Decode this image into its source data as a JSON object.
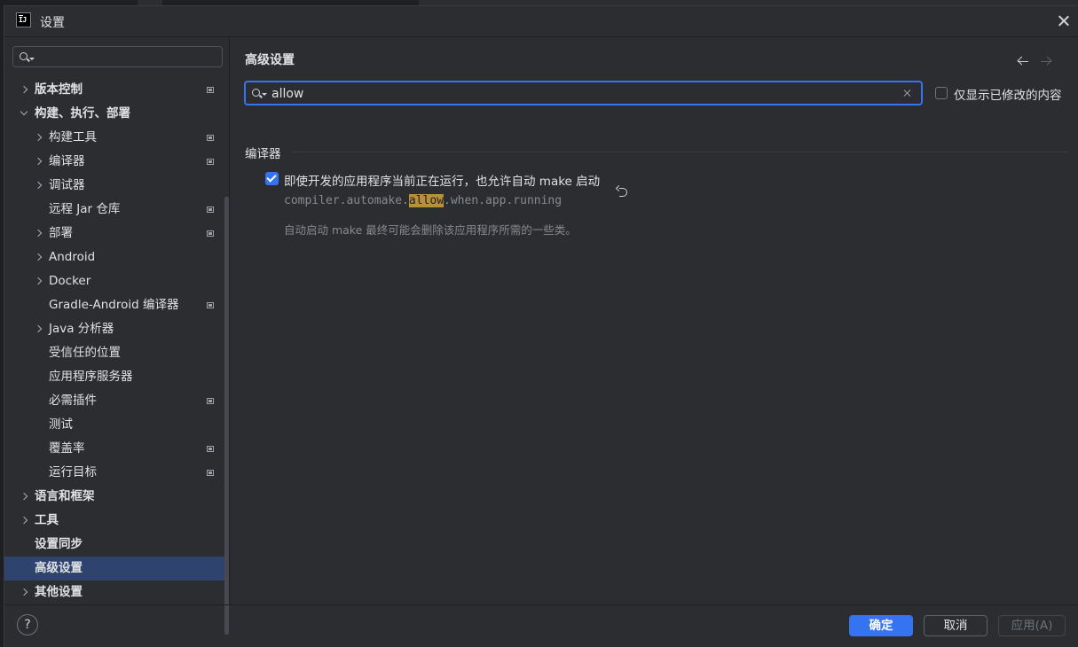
{
  "window": {
    "title": "设置",
    "logo_text": "IJ"
  },
  "sidebar": {
    "search_value": "",
    "items": [
      {
        "label": "版本控制",
        "level": 0,
        "expand": "collapsed",
        "bold": true,
        "has_icon": true,
        "selected": false
      },
      {
        "label": "构建、执行、部署",
        "level": 0,
        "expand": "expanded",
        "bold": true,
        "has_icon": false,
        "selected": false
      },
      {
        "label": "构建工具",
        "level": 1,
        "expand": "collapsed",
        "bold": false,
        "has_icon": true,
        "selected": false
      },
      {
        "label": "编译器",
        "level": 1,
        "expand": "collapsed",
        "bold": false,
        "has_icon": true,
        "selected": false
      },
      {
        "label": "调试器",
        "level": 1,
        "expand": "collapsed",
        "bold": false,
        "has_icon": false,
        "selected": false
      },
      {
        "label": "远程 Jar 仓库",
        "level": 1,
        "expand": "none",
        "bold": false,
        "has_icon": true,
        "selected": false
      },
      {
        "label": "部署",
        "level": 1,
        "expand": "collapsed",
        "bold": false,
        "has_icon": true,
        "selected": false
      },
      {
        "label": "Android",
        "level": 1,
        "expand": "collapsed",
        "bold": false,
        "has_icon": false,
        "selected": false
      },
      {
        "label": "Docker",
        "level": 1,
        "expand": "collapsed",
        "bold": false,
        "has_icon": false,
        "selected": false
      },
      {
        "label": "Gradle-Android 编译器",
        "level": 1,
        "expand": "none",
        "bold": false,
        "has_icon": true,
        "selected": false
      },
      {
        "label": "Java 分析器",
        "level": 1,
        "expand": "collapsed",
        "bold": false,
        "has_icon": false,
        "selected": false
      },
      {
        "label": "受信任的位置",
        "level": 1,
        "expand": "none",
        "bold": false,
        "has_icon": false,
        "selected": false
      },
      {
        "label": "应用程序服务器",
        "level": 1,
        "expand": "none",
        "bold": false,
        "has_icon": false,
        "selected": false
      },
      {
        "label": "必需插件",
        "level": 1,
        "expand": "none",
        "bold": false,
        "has_icon": true,
        "selected": false
      },
      {
        "label": "测试",
        "level": 1,
        "expand": "none",
        "bold": false,
        "has_icon": false,
        "selected": false
      },
      {
        "label": "覆盖率",
        "level": 1,
        "expand": "none",
        "bold": false,
        "has_icon": true,
        "selected": false
      },
      {
        "label": "运行目标",
        "level": 1,
        "expand": "none",
        "bold": false,
        "has_icon": true,
        "selected": false
      },
      {
        "label": "语言和框架",
        "level": 0,
        "expand": "collapsed",
        "bold": true,
        "has_icon": false,
        "selected": false
      },
      {
        "label": "工具",
        "level": 0,
        "expand": "collapsed",
        "bold": true,
        "has_icon": false,
        "selected": false
      },
      {
        "label": "设置同步",
        "level": 0,
        "expand": "none",
        "bold": true,
        "has_icon": false,
        "selected": false
      },
      {
        "label": "高级设置",
        "level": 0,
        "expand": "none",
        "bold": true,
        "has_icon": false,
        "selected": true
      },
      {
        "label": "其他设置",
        "level": 0,
        "expand": "collapsed",
        "bold": true,
        "has_icon": false,
        "selected": false
      }
    ]
  },
  "main": {
    "title": "高级设置",
    "search_value": "allow",
    "only_modified_label": "仅显示已修改的内容",
    "only_modified_checked": false,
    "section_title": "编译器",
    "option": {
      "label": "即使开发的应用程序当前正在运行，也允许自动 make 启动",
      "checked": true,
      "key_prefix": "compiler.automake.",
      "key_match": "allow",
      "key_suffix": ".when.app.running",
      "description": "自动启动 make 最终可能会删除该应用程序所需的一些类。"
    }
  },
  "footer": {
    "help_label": "?",
    "ok_label": "确定",
    "cancel_label": "取消",
    "apply_label": "应用(A)"
  }
}
